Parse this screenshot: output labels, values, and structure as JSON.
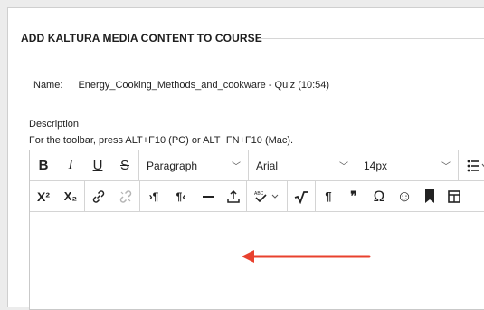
{
  "section": {
    "title": "ADD KALTURA MEDIA CONTENT TO COURSE"
  },
  "name": {
    "label": "Name:",
    "value": "Energy_Cooking_Methods_and_cookware - Quiz (10:54)"
  },
  "description": {
    "label": "Description",
    "hint": "For the toolbar, press ALT+F10 (PC) or ALT+FN+F10 (Mac)."
  },
  "toolbar": {
    "bold": "B",
    "italic": "I",
    "underline": "U",
    "strike": "S",
    "paragraph": "Paragraph",
    "font": "Arial",
    "size": "14px",
    "superscript": "X²",
    "subscript": "X₂",
    "pilcrow": "¶",
    "quote": "❞",
    "omega": "Ω",
    "smiley": "☺"
  },
  "colors": {
    "arrow": "#e8412e"
  }
}
